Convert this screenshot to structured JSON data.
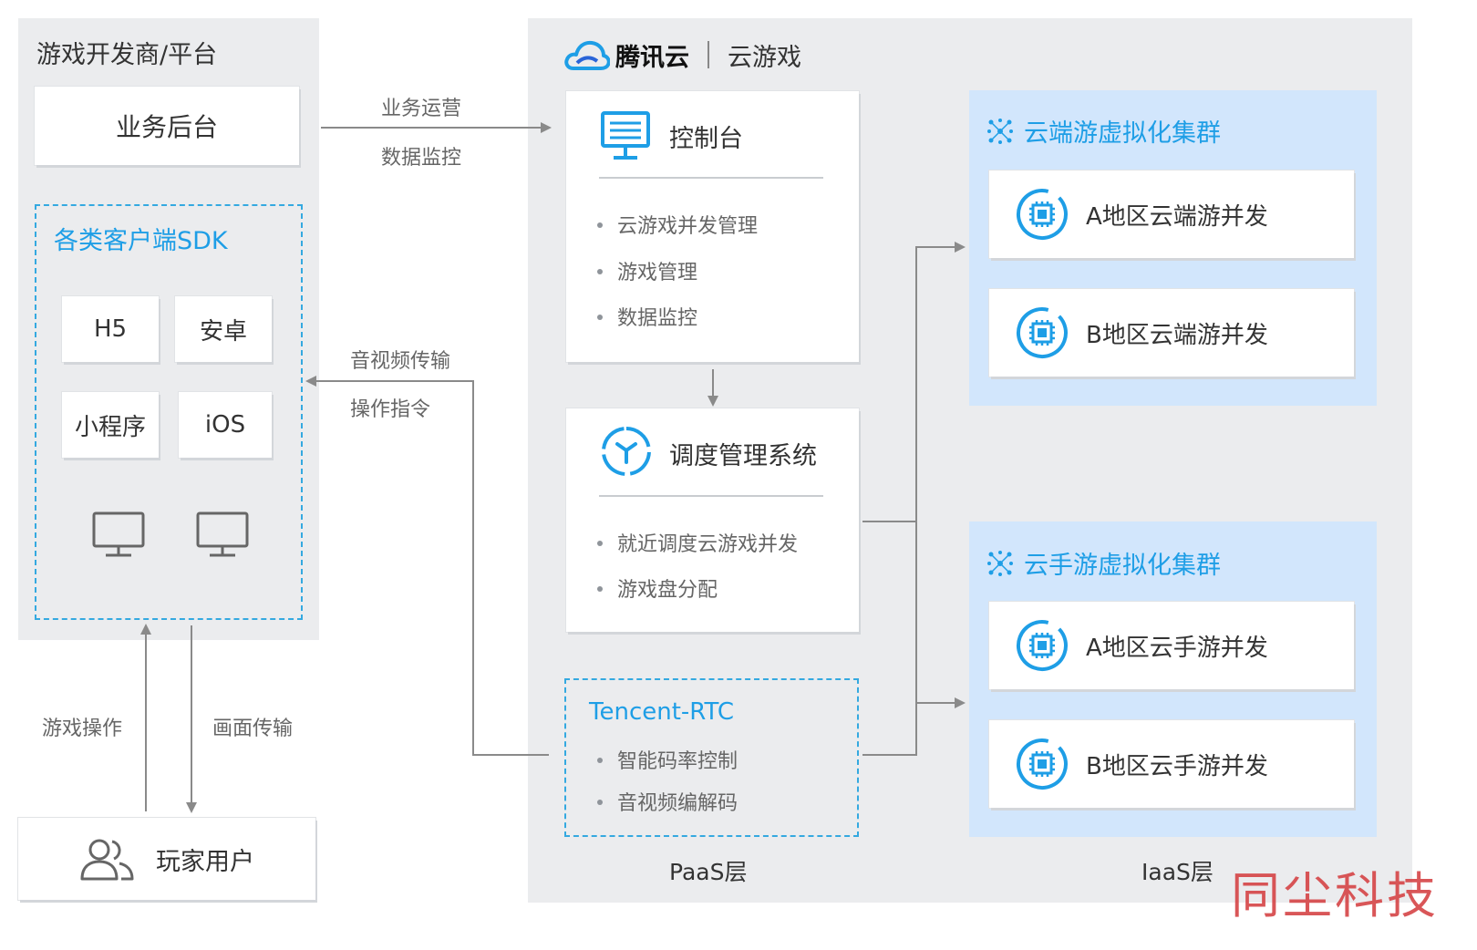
{
  "dev_platform": {
    "title": "游戏开发商/平台",
    "backend": "业务后台",
    "sdk_title": "各类客户端SDK",
    "sdk_items": [
      "H5",
      "安卓",
      "小程序",
      "iOS"
    ]
  },
  "links": {
    "biz_ops": "业务运营",
    "data_monitor": "数据监控",
    "av_transfer": "音视频传输",
    "op_command": "操作指令",
    "game_ops": "游戏操作",
    "frame_transfer": "画面传输"
  },
  "player": {
    "label": "玩家用户"
  },
  "tencent": {
    "brand": "腾讯云",
    "product": "云游戏"
  },
  "console": {
    "title": "控制台",
    "bullets": [
      "云游戏并发管理",
      "游戏管理",
      "数据监控"
    ]
  },
  "scheduler": {
    "title": "调度管理系统",
    "bullets": [
      "就近调度云游戏并发",
      "游戏盘分配"
    ]
  },
  "rtc": {
    "title": "Tencent-RTC",
    "bullets": [
      "智能码率控制",
      "音视频编解码"
    ]
  },
  "paas_label": "PaaS层",
  "iaas_label": "IaaS层",
  "cluster_pc": {
    "title": "云端游虚拟化集群",
    "items": [
      "A地区云端游并发",
      "B地区云端游并发"
    ]
  },
  "cluster_mobile": {
    "title": "云手游虚拟化集群",
    "items": [
      "A地区云手游并发",
      "B地区云手游并发"
    ]
  },
  "watermark": "同尘科技",
  "colors": {
    "accent_blue": "#1e9ee6",
    "panel_gray": "#ebecee",
    "cluster_blue": "#d2e6fc",
    "line_gray": "#888888",
    "watermark_red": "#d6484a"
  }
}
